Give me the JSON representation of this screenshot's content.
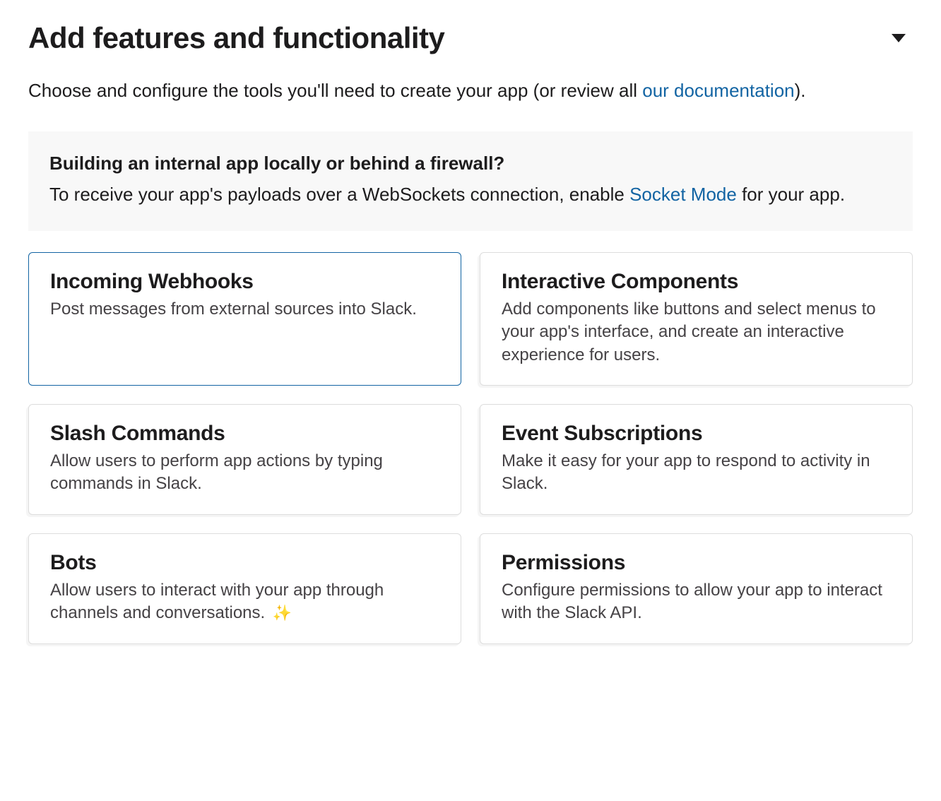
{
  "header": {
    "title": "Add features and functionality"
  },
  "subtitle": {
    "prefix": "Choose and configure the tools you'll need to create your app (or review all ",
    "link": "our documentation",
    "suffix": ")."
  },
  "infoBox": {
    "title": "Building an internal app locally or behind a firewall?",
    "text_before": "To receive your app's payloads over a WebSockets connection, enable ",
    "link": "Socket Mode",
    "text_after": " for your app."
  },
  "cards": [
    {
      "title": "Incoming Webhooks",
      "desc": "Post messages from external sources into Slack.",
      "selected": true,
      "sparkle": false
    },
    {
      "title": "Interactive Components",
      "desc": "Add components like buttons and select menus to your app's interface, and create an interactive experience for users.",
      "selected": false,
      "sparkle": false
    },
    {
      "title": "Slash Commands",
      "desc": "Allow users to perform app actions by typing commands in Slack.",
      "selected": false,
      "sparkle": false
    },
    {
      "title": "Event Subscriptions",
      "desc": "Make it easy for your app to respond to activity in Slack.",
      "selected": false,
      "sparkle": false
    },
    {
      "title": "Bots",
      "desc": "Allow users to interact with your app through channels and conversations.",
      "selected": false,
      "sparkle": true
    },
    {
      "title": "Permissions",
      "desc": "Configure permissions to allow your app to interact with the Slack API.",
      "selected": false,
      "sparkle": false
    }
  ],
  "icons": {
    "sparkle": "✨"
  }
}
